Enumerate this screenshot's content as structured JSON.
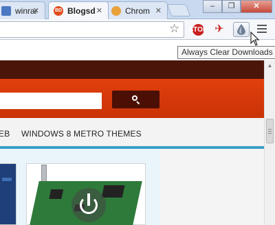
{
  "browser": {
    "tabs": [
      {
        "label": "winrar",
        "favicon_color": "#4a78c2",
        "active": false
      },
      {
        "label": "Blogsd",
        "favicon_color": "#e04e1f",
        "active": true,
        "favicon_text": "BD"
      },
      {
        "label": "Chrom",
        "favicon_color": "#e9a13a",
        "active": false
      }
    ],
    "close_glyph": "✕",
    "window_controls": {
      "minimize": "–",
      "maximize": "❐",
      "close": "✕"
    },
    "bookmark_star": "☆",
    "extensions": [
      {
        "name": "stop-icon",
        "glyph": "✋"
      },
      {
        "name": "plane-icon",
        "glyph": "✈"
      },
      {
        "name": "drop-icon",
        "glyph": "💧"
      }
    ],
    "tooltip": "Always Clear Downloads"
  },
  "site": {
    "header_color": "#4c1509",
    "accent_color": "#e03f0e",
    "nav_items": [
      "EB",
      "WINDOWS 8 METRO THEMES"
    ],
    "nav_accent": "#39a0c9"
  }
}
